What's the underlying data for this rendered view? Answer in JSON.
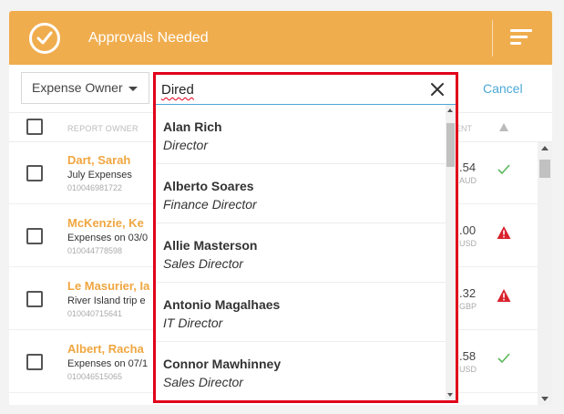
{
  "header": {
    "title": "Approvals Needed",
    "check_icon": "check-circle-icon",
    "menu_icon": "sort-menu-icon",
    "color": "#f0ad4e"
  },
  "filter": {
    "owner_select_value": "Expense Owner",
    "search_value": "Dired",
    "cancel_label": "Cancel",
    "accent": "#4aa8d8"
  },
  "columns": {
    "owner": "REPORT OWNER",
    "amount": "ENT"
  },
  "reports": [
    {
      "name": "Dart, Sarah",
      "desc": "July Expenses",
      "num": "010046981722",
      "amount": ".54",
      "currency": "AUD",
      "status": "approved"
    },
    {
      "name": "McKenzie, Ke",
      "desc": "Expenses on 03/0",
      "num": "010044778598",
      "amount": ".00",
      "currency": "USD",
      "status": "warning"
    },
    {
      "name": "Le Masurier, Ia",
      "desc": "River Island trip e",
      "num": "010040715641",
      "amount": ".32",
      "currency": "GBP",
      "status": "warning"
    },
    {
      "name": "Albert, Racha",
      "desc": "Expenses on 07/1",
      "num": "010046515065",
      "amount": ".58",
      "currency": "USD",
      "status": "approved"
    }
  ],
  "dropdown": {
    "highlight_color": "#e0001b",
    "options": [
      {
        "name": "Alan Rich",
        "title": "Director"
      },
      {
        "name": "Alberto Soares",
        "title": "Finance Director"
      },
      {
        "name": "Allie Masterson",
        "title": "Sales Director"
      },
      {
        "name": "Antonio Magalhaes",
        "title": "IT Director"
      },
      {
        "name": "Connor Mawhinney",
        "title": "Sales Director"
      }
    ]
  }
}
